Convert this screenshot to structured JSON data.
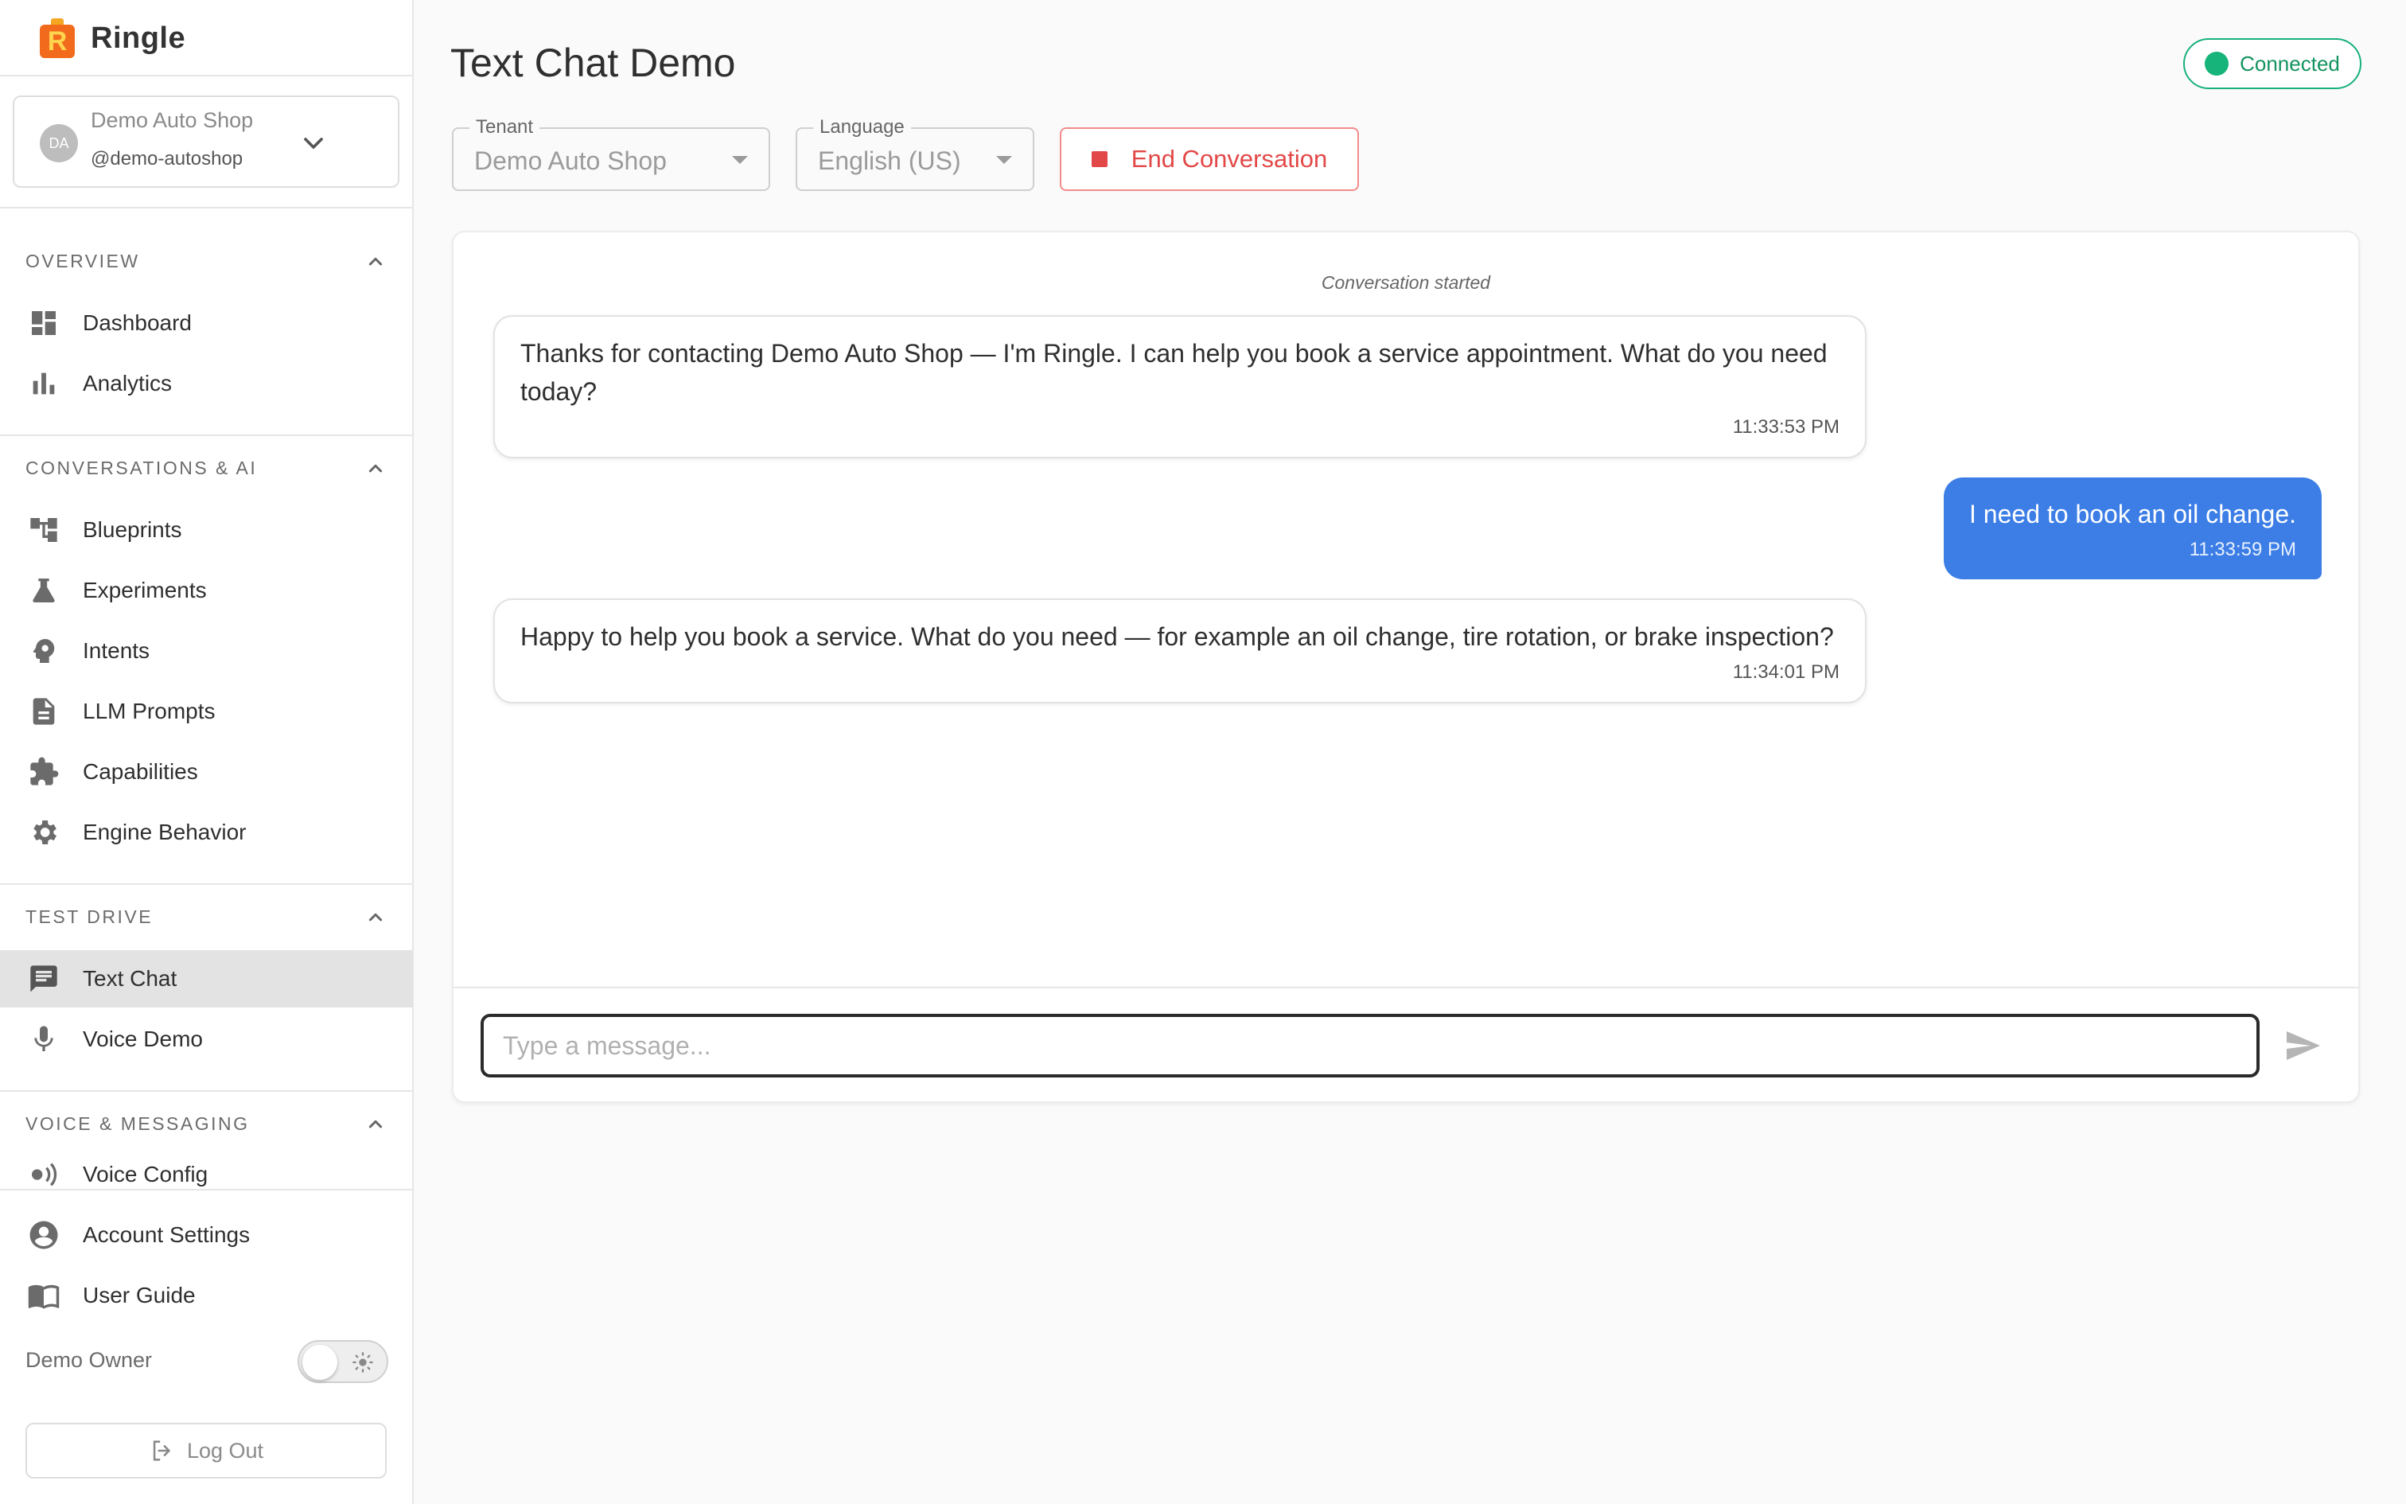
{
  "brand": {
    "name": "Ringle",
    "logo_letter": "R"
  },
  "tenant_switcher": {
    "avatar_initials": "DA",
    "name": "Demo Auto Shop",
    "handle": "@demo-autoshop"
  },
  "sidebar": {
    "sections": [
      {
        "title": "OVERVIEW",
        "items": [
          {
            "label": "Dashboard",
            "icon": "dashboard-icon"
          },
          {
            "label": "Analytics",
            "icon": "bar-chart-icon"
          }
        ]
      },
      {
        "title": "CONVERSATIONS & AI",
        "items": [
          {
            "label": "Blueprints",
            "icon": "account-tree-icon"
          },
          {
            "label": "Experiments",
            "icon": "flask-icon"
          },
          {
            "label": "Intents",
            "icon": "psychology-icon"
          },
          {
            "label": "LLM Prompts",
            "icon": "document-icon"
          },
          {
            "label": "Capabilities",
            "icon": "puzzle-icon"
          },
          {
            "label": "Engine Behavior",
            "icon": "gear-icon"
          }
        ]
      },
      {
        "title": "TEST DRIVE",
        "items": [
          {
            "label": "Text Chat",
            "icon": "chat-icon",
            "active": true
          },
          {
            "label": "Voice Demo",
            "icon": "microphone-icon"
          }
        ]
      },
      {
        "title": "VOICE & MESSAGING",
        "items": [
          {
            "label": "Voice Config",
            "icon": "voice-icon"
          }
        ]
      }
    ],
    "footer": {
      "account_settings": "Account Settings",
      "user_guide": "User Guide",
      "user_name": "Demo Owner",
      "logout": "Log Out"
    }
  },
  "main": {
    "title": "Text Chat Demo",
    "status": "Connected",
    "tenant_field": {
      "label": "Tenant",
      "value": "Demo Auto Shop"
    },
    "language_field": {
      "label": "Language",
      "value": "English (US)"
    },
    "end_button": "End Conversation",
    "conversation_started": "Conversation started",
    "messages": [
      {
        "role": "bot",
        "text": "Thanks for contacting Demo Auto Shop — I'm Ringle. I can help you book a service appointment. What do you need today?",
        "time": "11:33:53 PM"
      },
      {
        "role": "user",
        "text": "I need to book an oil change.",
        "time": "11:33:59 PM"
      },
      {
        "role": "bot",
        "text": "Happy to help you book a service. What do you need — for example an oil change, tire rotation, or brake inspection?",
        "time": "11:34:01 PM"
      }
    ],
    "input": {
      "placeholder": "Type a message...",
      "value": ""
    }
  },
  "colors": {
    "accent": "#3c7ee6",
    "connected": "#16b47a",
    "danger": "#e34848",
    "brand": "#f26b1d"
  }
}
